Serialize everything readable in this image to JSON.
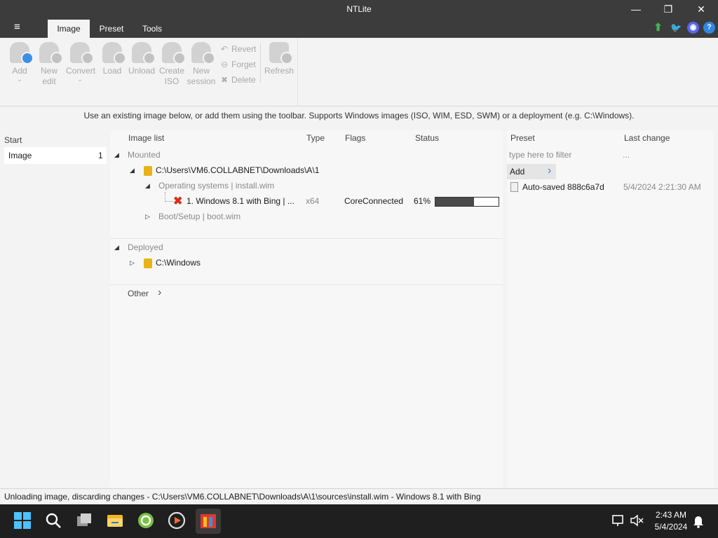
{
  "window": {
    "title": "NTLite",
    "minimize": "—",
    "restore": "❐",
    "close": "✕"
  },
  "menu": {
    "hamburger": "≡"
  },
  "tabs": [
    {
      "label": "Image",
      "active": true
    },
    {
      "label": "Preset"
    },
    {
      "label": "Tools"
    }
  ],
  "header_icons": {
    "update": "arrow-up-icon",
    "twitter": "twitter-icon",
    "discord": "discord-icon",
    "help": "?"
  },
  "toolbar": {
    "add": {
      "line1": "Add",
      "chevron": "⌄"
    },
    "new_edit": {
      "line1": "New",
      "line2": "edit"
    },
    "convert": {
      "line1": "Convert",
      "chevron": "⌄"
    },
    "load": {
      "line1": "Load"
    },
    "unload": {
      "line1": "Unload"
    },
    "create_iso": {
      "line1": "Create",
      "line2": "ISO"
    },
    "new_session": {
      "line1": "New",
      "line2": "session"
    },
    "revert": "Revert",
    "forget": "Forget",
    "delete": "Delete",
    "refresh": "Refresh"
  },
  "hint": "Use an existing image below, or add them using the toolbar. Supports Windows images (ISO, WIM, ESD, SWM) or a deployment (e.g. C:\\Windows).",
  "sidebar": {
    "heading": "Start",
    "items": [
      {
        "label": "Image",
        "count": "1"
      }
    ]
  },
  "image_list": {
    "columns": {
      "name": "Image list",
      "type": "Type",
      "flags": "Flags",
      "status": "Status"
    },
    "mounted_label": "Mounted",
    "mounted_path": "C:\\Users\\VM6.COLLABNET\\Downloads\\A\\1",
    "os_group": "Operating systems  |  install.wim",
    "image_entry": {
      "name": "1. Windows 8.1 with Bing  |  ...",
      "type": "x64",
      "flags": "CoreConnected",
      "status": "61%",
      "progress": 0.61
    },
    "boot_group": "Boot/Setup  |  boot.wim",
    "deployed_label": "Deployed",
    "deployed_path": "C:\\Windows",
    "other_label": "Other",
    "other_chevron": "›"
  },
  "preset_panel": {
    "columns": {
      "name": "Preset",
      "last_change": "Last change"
    },
    "filter_placeholder": "type here to filter",
    "filter_ellipsis": "...",
    "add_label": "Add",
    "add_chevron": "›",
    "items": [
      {
        "name": "Auto-saved 888c6a7d",
        "date": "5/4/2024 2:21:30 AM"
      }
    ]
  },
  "status_bar": "Unloading image, discarding changes - C:\\Users\\VM6.COLLABNET\\Downloads\\A\\1\\sources\\install.wim - Windows 8.1 with Bing",
  "taskbar": {
    "apps": [
      "windows-start-icon",
      "search-icon",
      "task-view-icon",
      "file-explorer-icon",
      "app-green-icon",
      "media-player-icon",
      "ntlite-icon"
    ],
    "time": "2:43 AM",
    "date": "5/4/2024"
  },
  "colors": {
    "titlebar": "#3c3c3c",
    "accent": "#3d8ee6",
    "error": "#d83020",
    "folder": "#e8b218"
  }
}
